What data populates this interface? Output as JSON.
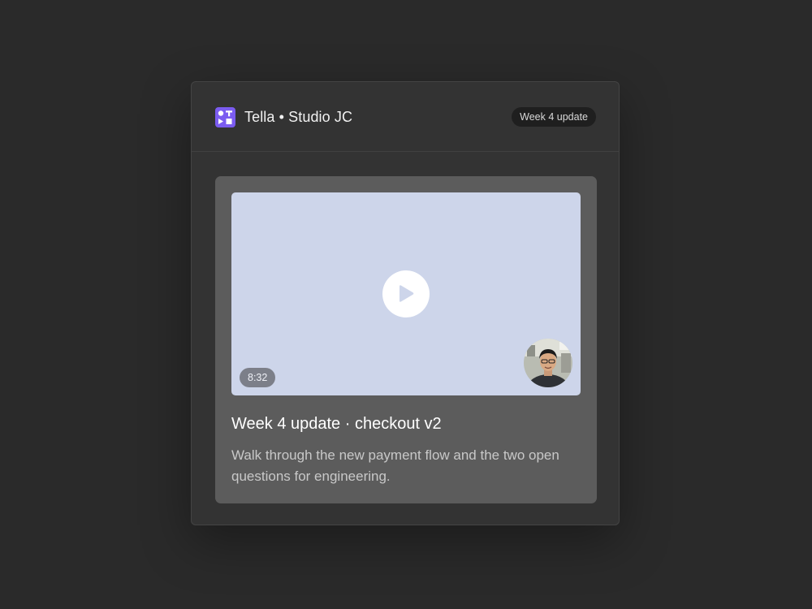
{
  "header": {
    "brand": "Tella • Studio JC",
    "logo_icon": "tella-logo-icon",
    "badge": "Week 4 update"
  },
  "video": {
    "duration": "8:32",
    "title": "Week 4 update · checkout v2",
    "description": "Walk through the new payment flow and the two open questions for engineering.",
    "play_icon": "play-icon",
    "avatar": "presenter-avatar"
  },
  "colors": {
    "background": "#2a2a2a",
    "card": "#333333",
    "video_card": "#5c5c5c",
    "player": "#cdd5ea",
    "brand_accent": "#7b5cf0"
  }
}
